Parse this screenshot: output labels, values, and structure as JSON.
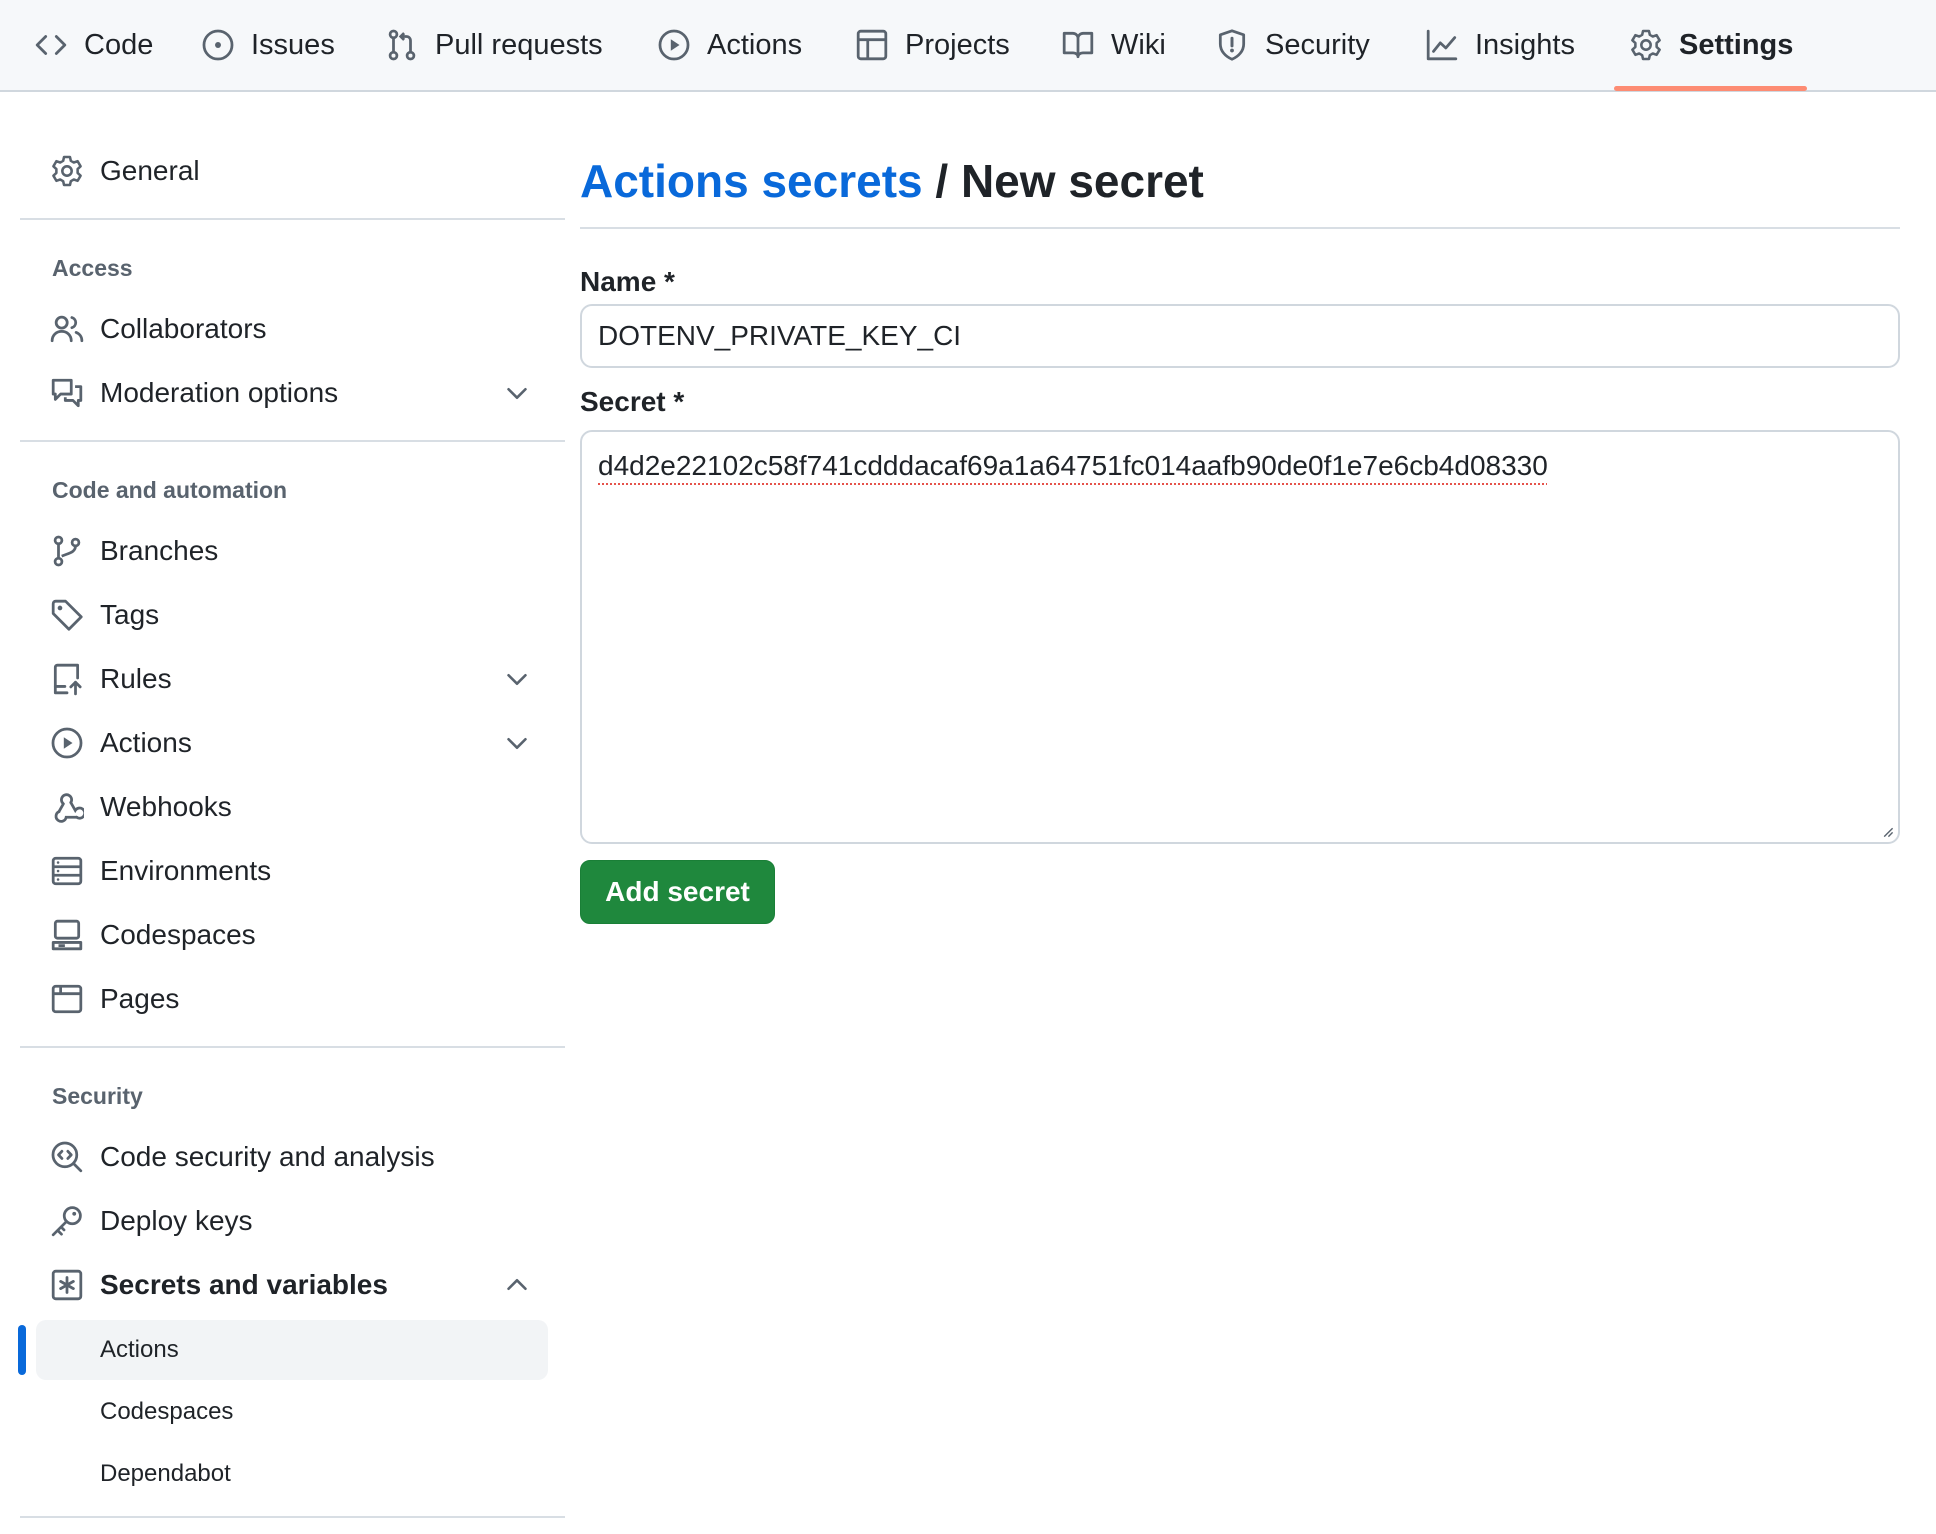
{
  "repo_nav": {
    "tabs": [
      {
        "label": "Code",
        "icon": "code-icon"
      },
      {
        "label": "Issues",
        "icon": "issue-opened-icon"
      },
      {
        "label": "Pull requests",
        "icon": "git-pull-request-icon"
      },
      {
        "label": "Actions",
        "icon": "play-icon"
      },
      {
        "label": "Projects",
        "icon": "table-icon"
      },
      {
        "label": "Wiki",
        "icon": "book-icon"
      },
      {
        "label": "Security",
        "icon": "shield-icon"
      },
      {
        "label": "Insights",
        "icon": "graph-icon"
      },
      {
        "label": "Settings",
        "icon": "gear-icon"
      }
    ],
    "active_tab": "Settings",
    "active_underline_color": "#fd8c73"
  },
  "sidebar": {
    "general": {
      "label": "General",
      "icon": "gear-icon"
    },
    "sections": [
      {
        "heading": "Access",
        "items": [
          {
            "label": "Collaborators",
            "icon": "people-icon"
          },
          {
            "label": "Moderation options",
            "icon": "comment-discussion-icon",
            "expandable": true
          }
        ]
      },
      {
        "heading": "Code and automation",
        "items": [
          {
            "label": "Branches",
            "icon": "git-branch-icon"
          },
          {
            "label": "Tags",
            "icon": "tag-icon"
          },
          {
            "label": "Rules",
            "icon": "repo-push-icon",
            "expandable": true
          },
          {
            "label": "Actions",
            "icon": "play-icon",
            "expandable": true
          },
          {
            "label": "Webhooks",
            "icon": "webhook-icon"
          },
          {
            "label": "Environments",
            "icon": "server-icon"
          },
          {
            "label": "Codespaces",
            "icon": "codespaces-icon"
          },
          {
            "label": "Pages",
            "icon": "browser-icon"
          }
        ]
      },
      {
        "heading": "Security",
        "items": [
          {
            "label": "Code security and analysis",
            "icon": "codescan-icon"
          },
          {
            "label": "Deploy keys",
            "icon": "key-icon"
          },
          {
            "label": "Secrets and variables",
            "icon": "key-asterisk-icon",
            "expanded": true
          }
        ]
      }
    ],
    "secrets_subitems": [
      {
        "label": "Actions",
        "selected": true
      },
      {
        "label": "Codespaces"
      },
      {
        "label": "Dependabot"
      }
    ],
    "selection_color": "#0969da"
  },
  "page": {
    "breadcrumb_link": "Actions secrets",
    "separator": "/",
    "current": "New secret"
  },
  "form": {
    "name_label": "Name *",
    "name_value": "DOTENV_PRIVATE_KEY_CI",
    "secret_label": "Secret *",
    "secret_value": "d4d2e22102c58f741cdddacaf69a1a64751fc014aafb90de0f1e7e6cb4d08330",
    "submit_label": "Add secret",
    "submit_color": "#1f883d"
  }
}
